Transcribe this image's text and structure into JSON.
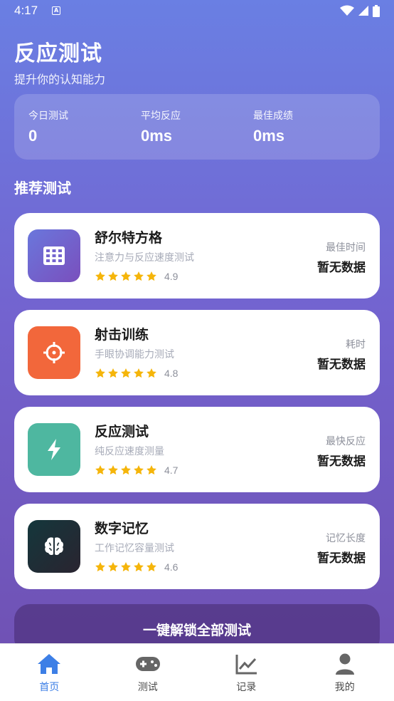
{
  "status": {
    "time": "4:17"
  },
  "header": {
    "title": "反应测试",
    "subtitle": "提升你的认知能力"
  },
  "stats": [
    {
      "label": "今日测试",
      "value": "0"
    },
    {
      "label": "平均反应",
      "value": "0ms"
    },
    {
      "label": "最佳成绩",
      "value": "0ms"
    }
  ],
  "section_title": "推荐测试",
  "tests": [
    {
      "name": "舒尔特方格",
      "desc": "注意力与反应速度测试",
      "rating": "4.9",
      "metric_label": "最佳时间",
      "metric_value": "暂无数据",
      "icon": "grid-icon",
      "color": "#6f67d2"
    },
    {
      "name": "射击训练",
      "desc": "手眼协调能力测试",
      "rating": "4.8",
      "metric_label": "耗时",
      "metric_value": "暂无数据",
      "icon": "crosshair-icon",
      "color": "#f2673b"
    },
    {
      "name": "反应测试",
      "desc": "纯反应速度测量",
      "rating": "4.7",
      "metric_label": "最快反应",
      "metric_value": "暂无数据",
      "icon": "lightning-icon",
      "color": "#4eb7a0"
    },
    {
      "name": "数字记忆",
      "desc": "工作记忆容量测试",
      "rating": "4.6",
      "metric_label": "记忆长度",
      "metric_value": "暂无数据",
      "icon": "brain-icon",
      "color": "#1d2a30"
    }
  ],
  "unlock_label": "一键解锁全部测试",
  "tabs": [
    {
      "label": "首页",
      "icon": "home-icon",
      "active": true
    },
    {
      "label": "测试",
      "icon": "gamepad-icon",
      "active": false
    },
    {
      "label": "记录",
      "icon": "chart-icon",
      "active": false
    },
    {
      "label": "我的",
      "icon": "person-icon",
      "active": false
    }
  ],
  "colors": {
    "accent": "#3d7fe6",
    "star": "#f5b50a"
  }
}
